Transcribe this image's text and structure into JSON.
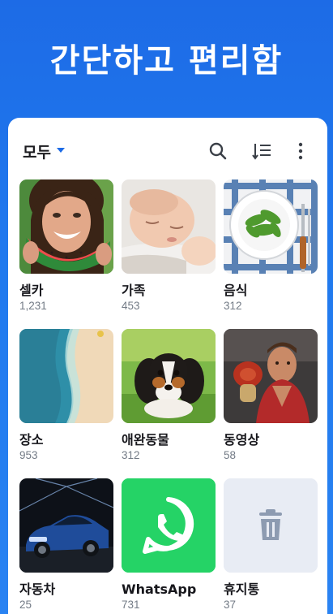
{
  "headline": "간단하고 편리함",
  "toolbar": {
    "album_filter": "모두",
    "icons": [
      "search-icon",
      "sort-icon",
      "more-icon"
    ]
  },
  "albums": [
    {
      "name": "셀카",
      "count": "1,231"
    },
    {
      "name": "가족",
      "count": "453"
    },
    {
      "name": "음식",
      "count": "312"
    },
    {
      "name": "장소",
      "count": "953"
    },
    {
      "name": "애완동물",
      "count": "312"
    },
    {
      "name": "동영상",
      "count": "58"
    },
    {
      "name": "자동차",
      "count": "25"
    },
    {
      "name": "WhatsApp",
      "count": "731"
    },
    {
      "name": "휴지통",
      "count": "37"
    }
  ],
  "colors": {
    "background": "#1d6be6",
    "accent": "#1d6be6",
    "whatsapp_green": "#25d366",
    "trash_bg": "#e8ecf4"
  }
}
